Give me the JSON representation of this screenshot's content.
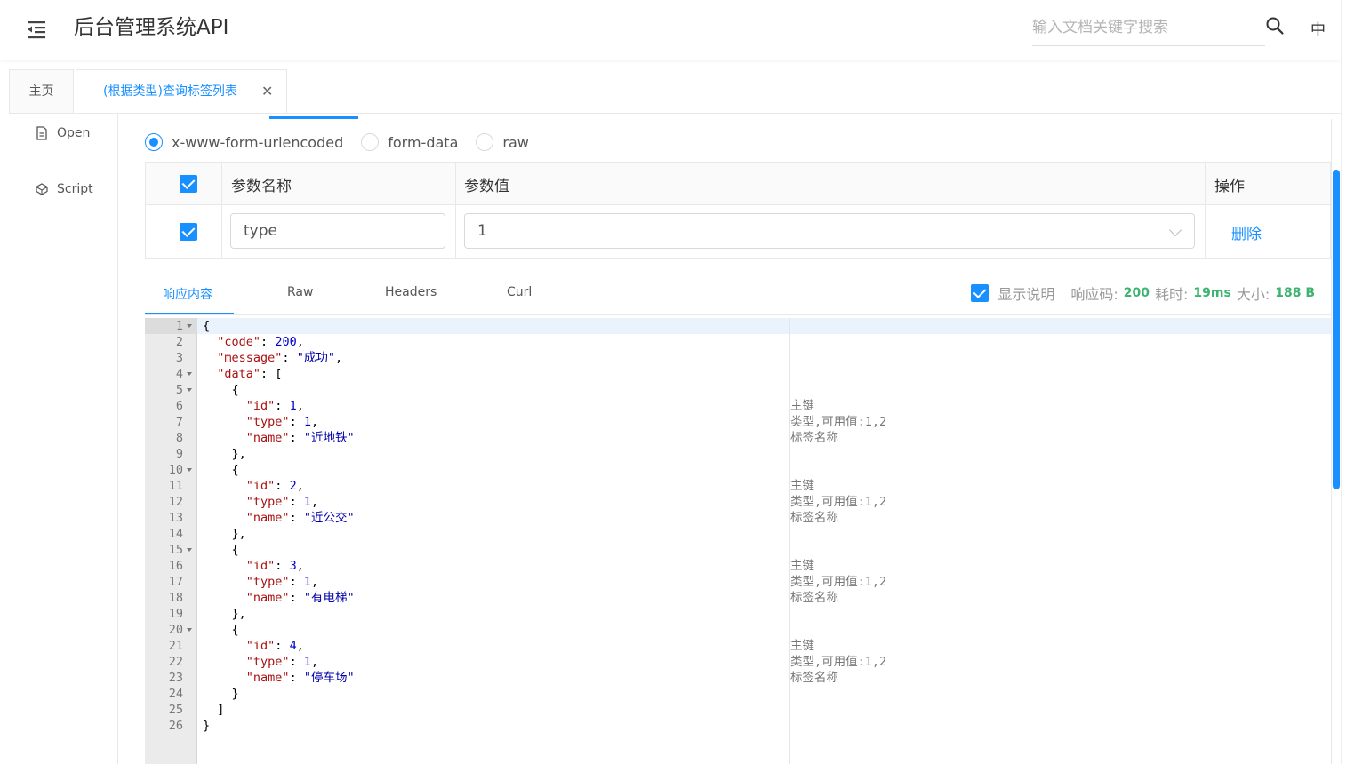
{
  "header": {
    "title": "后台管理系统API",
    "search_placeholder": "输入文档关键字搜索",
    "lang": "中"
  },
  "tabs": [
    {
      "label": "主页"
    },
    {
      "label": "(根据类型)查询标签列表"
    }
  ],
  "side_menu": [
    {
      "label": "Open",
      "icon": "document-icon"
    },
    {
      "label": "Script",
      "icon": "code-icon"
    }
  ],
  "content_types": [
    {
      "label": "x-www-form-urlencoded",
      "selected": true
    },
    {
      "label": "form-data",
      "selected": false
    },
    {
      "label": "raw",
      "selected": false
    }
  ],
  "params_table": {
    "headers": [
      "参数名称",
      "参数值",
      "操作"
    ],
    "rows": [
      {
        "checked": true,
        "name": "type",
        "value": "1",
        "action": "删除"
      }
    ]
  },
  "response_tabs": [
    {
      "label": "响应内容",
      "active": true
    },
    {
      "label": "Raw",
      "active": false
    },
    {
      "label": "Headers",
      "active": false
    },
    {
      "label": "Curl",
      "active": false
    }
  ],
  "response_meta": {
    "show_desc_label": "显示说明",
    "show_desc_checked": true,
    "code_label": "响应码:",
    "code": "200",
    "time_label": "耗时:",
    "time": "19ms",
    "size_label": "大小:",
    "size": "188 B"
  },
  "editor_lines": [
    {
      "n": "1",
      "fold": true,
      "code": "{",
      "desc": ""
    },
    {
      "n": "2",
      "fold": false,
      "code": "  \"code\": 200,",
      "desc": ""
    },
    {
      "n": "3",
      "fold": false,
      "code": "  \"message\": \"成功\",",
      "desc": ""
    },
    {
      "n": "4",
      "fold": true,
      "code": "  \"data\": [",
      "desc": ""
    },
    {
      "n": "5",
      "fold": true,
      "code": "    {",
      "desc": ""
    },
    {
      "n": "6",
      "fold": false,
      "code": "      \"id\": 1,",
      "desc": "主键"
    },
    {
      "n": "7",
      "fold": false,
      "code": "      \"type\": 1,",
      "desc": "类型,可用值:1,2"
    },
    {
      "n": "8",
      "fold": false,
      "code": "      \"name\": \"近地铁\"",
      "desc": "标签名称"
    },
    {
      "n": "9",
      "fold": false,
      "code": "    },",
      "desc": ""
    },
    {
      "n": "10",
      "fold": true,
      "code": "    {",
      "desc": ""
    },
    {
      "n": "11",
      "fold": false,
      "code": "      \"id\": 2,",
      "desc": "主键"
    },
    {
      "n": "12",
      "fold": false,
      "code": "      \"type\": 1,",
      "desc": "类型,可用值:1,2"
    },
    {
      "n": "13",
      "fold": false,
      "code": "      \"name\": \"近公交\"",
      "desc": "标签名称"
    },
    {
      "n": "14",
      "fold": false,
      "code": "    },",
      "desc": ""
    },
    {
      "n": "15",
      "fold": true,
      "code": "    {",
      "desc": ""
    },
    {
      "n": "16",
      "fold": false,
      "code": "      \"id\": 3,",
      "desc": "主键"
    },
    {
      "n": "17",
      "fold": false,
      "code": "      \"type\": 1,",
      "desc": "类型,可用值:1,2"
    },
    {
      "n": "18",
      "fold": false,
      "code": "      \"name\": \"有电梯\"",
      "desc": "标签名称"
    },
    {
      "n": "19",
      "fold": false,
      "code": "    },",
      "desc": ""
    },
    {
      "n": "20",
      "fold": true,
      "code": "    {",
      "desc": ""
    },
    {
      "n": "21",
      "fold": false,
      "code": "      \"id\": 4,",
      "desc": "主键"
    },
    {
      "n": "22",
      "fold": false,
      "code": "      \"type\": 1,",
      "desc": "类型,可用值:1,2"
    },
    {
      "n": "23",
      "fold": false,
      "code": "      \"name\": \"停车场\"",
      "desc": "标签名称"
    },
    {
      "n": "24",
      "fold": false,
      "code": "    }",
      "desc": ""
    },
    {
      "n": "25",
      "fold": false,
      "code": "  ]",
      "desc": ""
    },
    {
      "n": "26",
      "fold": false,
      "code": "}",
      "desc": ""
    }
  ],
  "colors": {
    "accent": "#1890ff",
    "success": "#3cb371"
  }
}
